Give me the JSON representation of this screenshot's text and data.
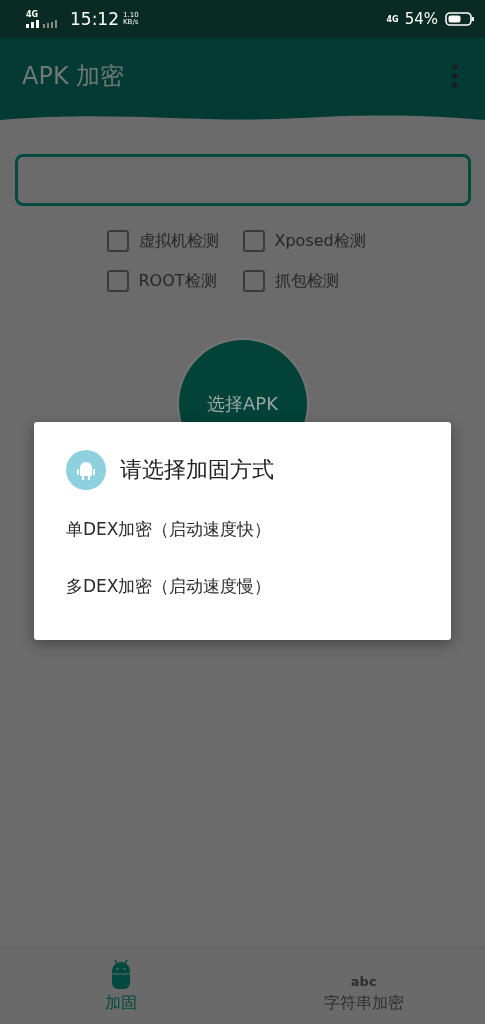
{
  "status_bar": {
    "signal_label": "4G",
    "time": "15:12",
    "speed": "1.10",
    "speed_unit": "KB/s",
    "network": "4G",
    "battery": "54%"
  },
  "app_bar": {
    "title": "APK 加密"
  },
  "checkboxes": [
    {
      "label": "虚拟机检测",
      "checked": false
    },
    {
      "label": "Xposed检测",
      "checked": false
    },
    {
      "label": "ROOT检测",
      "checked": false
    },
    {
      "label": "抓包检测",
      "checked": false
    }
  ],
  "select_button": {
    "label": "选择APK"
  },
  "dialog": {
    "title": "请选择加固方式",
    "options": [
      "单DEX加密（启动速度快）",
      "多DEX加密（启动速度慢）"
    ]
  },
  "bottom_nav": [
    {
      "kind": "android",
      "label": "加固",
      "selected": true
    },
    {
      "kind": "text",
      "icon_text": "abc",
      "label": "字符串加密",
      "selected": false
    }
  ]
}
